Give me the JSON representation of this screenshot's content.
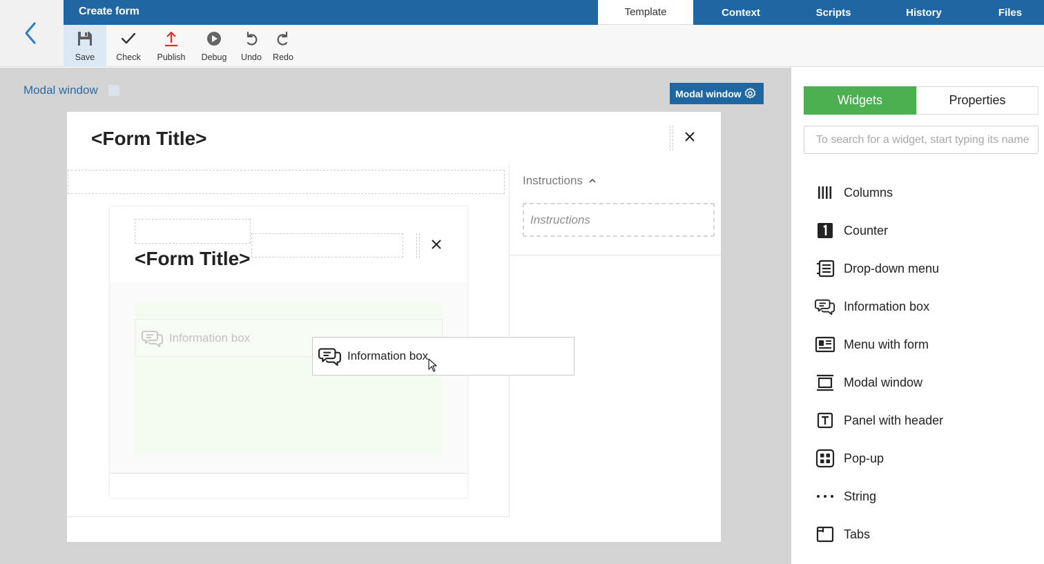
{
  "header": {
    "title": "Create form",
    "tabs": [
      {
        "label": "Template",
        "active": true
      },
      {
        "label": "Context"
      },
      {
        "label": "Scripts"
      },
      {
        "label": "History"
      },
      {
        "label": "Files"
      }
    ]
  },
  "toolbar": {
    "save": "Save",
    "check": "Check",
    "publish": "Publish",
    "debug": "Debug",
    "undo": "Undo",
    "redo": "Redo"
  },
  "canvas": {
    "breadcrumb": "Modal window",
    "selected_badge": "Modal window",
    "outer_modal": {
      "title": "<Form Title>",
      "instructions_header": "Instructions",
      "instructions_placeholder": "Instructions"
    },
    "inner_modal": {
      "title": "<Form Title>",
      "ghost_widget": "Information box"
    },
    "dragging_widget": "Information box"
  },
  "right_panel": {
    "tabs": [
      "Widgets",
      "Properties"
    ],
    "search_placeholder": "To search for a widget, start typing its name",
    "widgets": [
      {
        "label": "Columns",
        "icon": "columns-icon"
      },
      {
        "label": "Counter",
        "icon": "counter-icon"
      },
      {
        "label": "Drop-down menu",
        "icon": "dropdown-menu-icon"
      },
      {
        "label": "Information box",
        "icon": "information-box-icon"
      },
      {
        "label": "Menu with form",
        "icon": "menu-with-form-icon"
      },
      {
        "label": "Modal window",
        "icon": "modal-window-icon"
      },
      {
        "label": "Panel with header",
        "icon": "panel-with-header-icon"
      },
      {
        "label": "Pop-up",
        "icon": "popup-icon"
      },
      {
        "label": "String",
        "icon": "string-icon"
      },
      {
        "label": "Tabs",
        "icon": "tabs-icon"
      }
    ]
  },
  "colors": {
    "brand_blue": "#1f67a3",
    "widgets_tab_green": "#4caf50",
    "publish_red": "#d9342b"
  }
}
